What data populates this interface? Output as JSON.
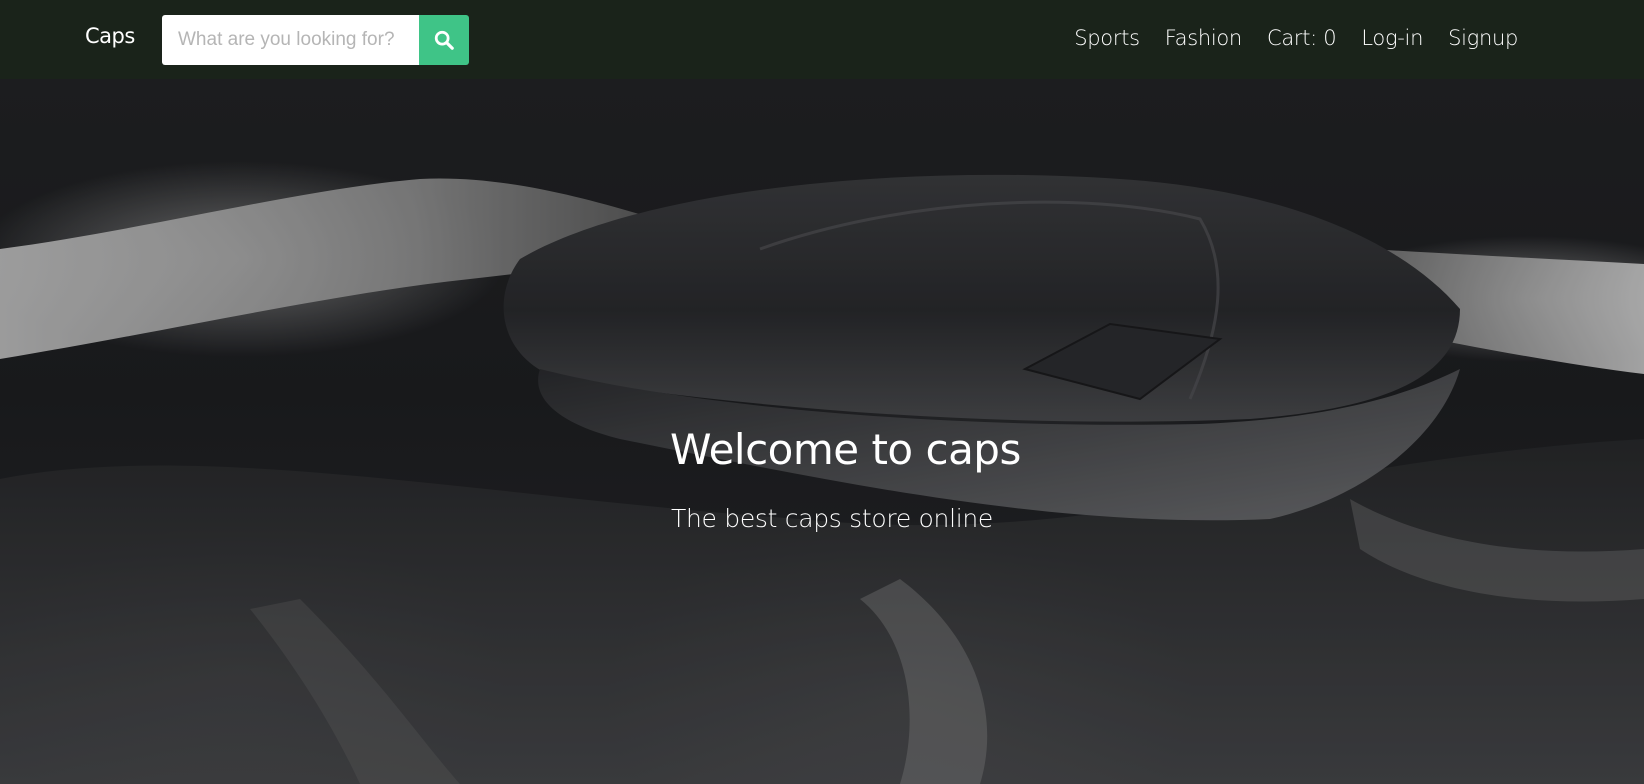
{
  "navbar": {
    "brand": "Caps",
    "search": {
      "placeholder": "What are you looking for?",
      "value": "",
      "button_icon": "search-icon"
    },
    "links": [
      {
        "label": "Sports"
      },
      {
        "label": "Fashion"
      },
      {
        "label": "Cart: 0"
      },
      {
        "label": "Log-in"
      },
      {
        "label": "Signup"
      }
    ]
  },
  "hero": {
    "title": "Welcome to caps",
    "subtitle": "The best caps store online",
    "image": "black-and-white-photo-of-person-holding-cap"
  },
  "colors": {
    "navbar_bg": "#1a231a",
    "accent": "#3fc487",
    "text": "#ffffff"
  }
}
